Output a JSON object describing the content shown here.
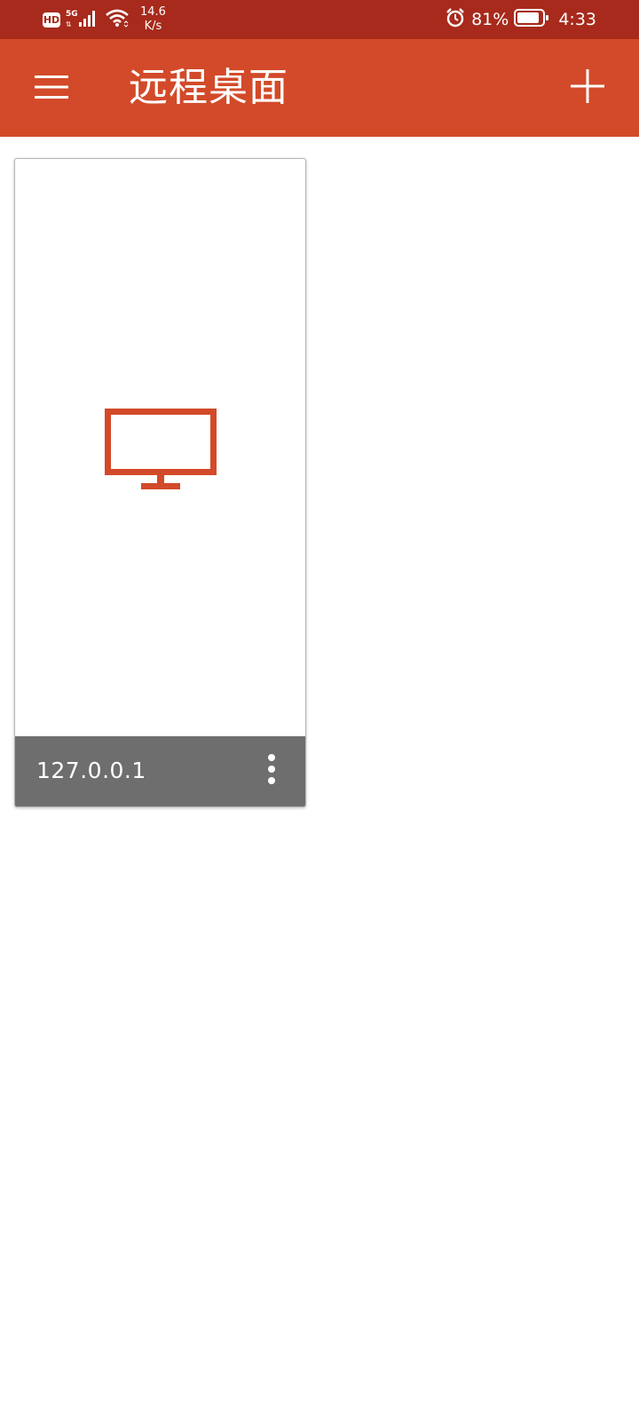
{
  "status_bar": {
    "hd_label": "HD",
    "network_type": "5G",
    "network_arrows": "⇅",
    "speed_value": "14.6",
    "speed_unit": "K/s",
    "battery_percent": "81%",
    "time": "4:33",
    "icons": [
      "hd-icon",
      "signal-icon",
      "wifi-icon",
      "alarm-icon",
      "battery-icon"
    ]
  },
  "app_bar": {
    "title": "远程桌面",
    "menu_icon": "hamburger-menu-icon",
    "add_icon": "plus-icon"
  },
  "pcs": [
    {
      "name": "127.0.0.1",
      "thumbnail_icon": "monitor-icon",
      "more_icon": "more-vertical-icon"
    }
  ],
  "colors": {
    "status_bar": "#A72A1C",
    "app_bar": "#D24A29",
    "accent": "#D24A29",
    "card_footer": "#6E6E6E",
    "background": "#FFFFFF"
  }
}
